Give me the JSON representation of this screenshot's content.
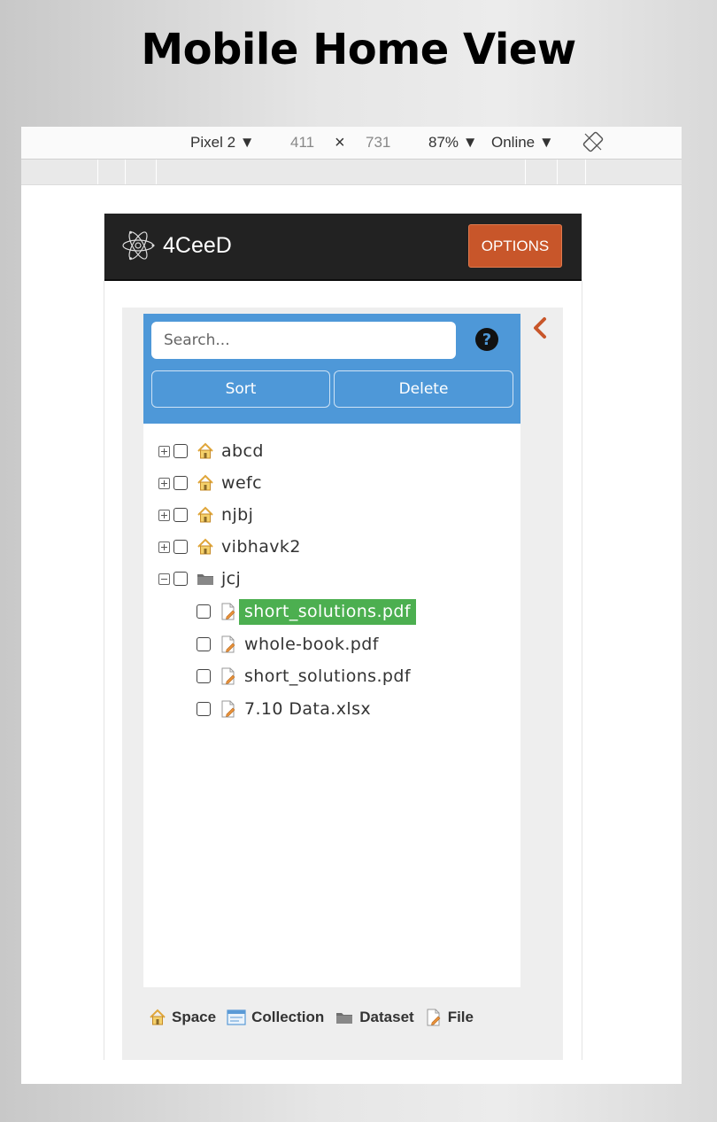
{
  "slide_title": "Mobile Home View",
  "devtools": {
    "device": "Pixel 2 ▼",
    "width": "411",
    "times": "×",
    "height": "731",
    "zoom": "87% ▼",
    "network": "Online ▼"
  },
  "app": {
    "brand": "4CeeD",
    "options_label": "OPTIONS"
  },
  "panel": {
    "search_placeholder": "Search...",
    "help": "?",
    "sort_label": "Sort",
    "delete_label": "Delete"
  },
  "tree": {
    "spaces": [
      {
        "label": "abcd",
        "icon": "home-icon",
        "expanded": false
      },
      {
        "label": "wefc",
        "icon": "home-icon",
        "expanded": false
      },
      {
        "label": "njbj",
        "icon": "home-icon",
        "expanded": false
      },
      {
        "label": "vibhavk2",
        "icon": "home-icon",
        "expanded": false
      }
    ],
    "dataset": {
      "label": "jcj",
      "icon": "folder-icon",
      "expanded": true
    },
    "files": [
      {
        "label": "short_solutions.pdf",
        "icon": "file-icon",
        "selected": true
      },
      {
        "label": "whole-book.pdf",
        "icon": "file-icon",
        "selected": false
      },
      {
        "label": "short_solutions.pdf",
        "icon": "file-icon",
        "selected": false
      },
      {
        "label": "7.10 Data.xlsx",
        "icon": "file-icon",
        "selected": false
      }
    ]
  },
  "legend": {
    "space": "Space",
    "collection": "Collection",
    "dataset": "Dataset",
    "file": "File"
  },
  "colors": {
    "navbar": "#222222",
    "options": "#c8562a",
    "panel_head": "#4e98d8",
    "selected": "#4caf50",
    "chevron": "#c8562a"
  }
}
